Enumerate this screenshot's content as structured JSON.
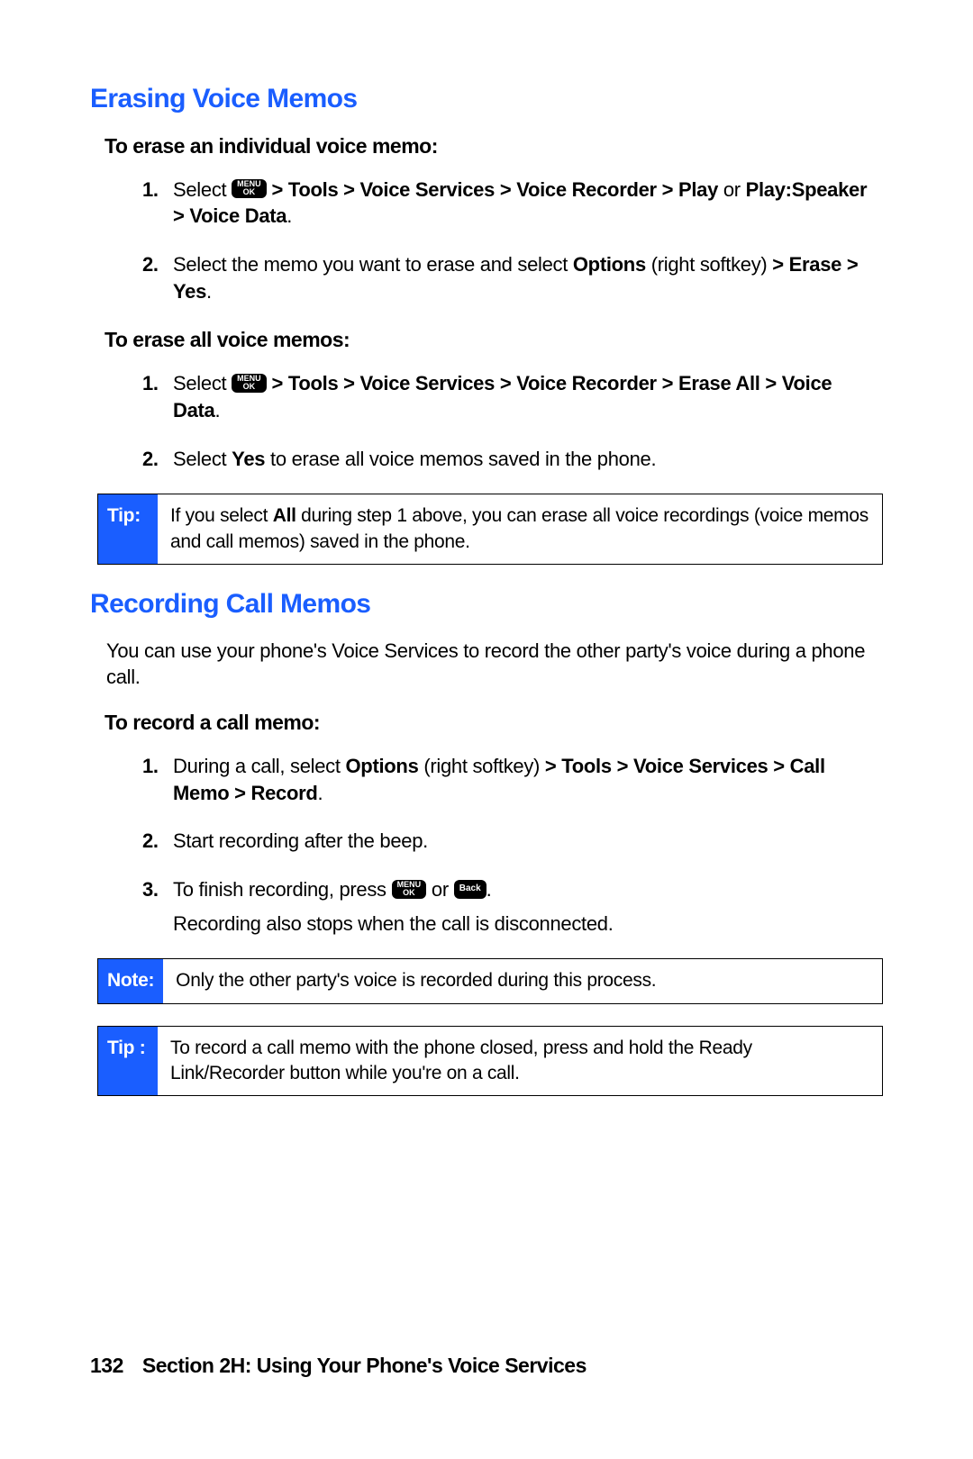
{
  "colors": {
    "accent": "#1a5eff"
  },
  "erasing": {
    "heading": "Erasing Voice Memos",
    "sub1": "To erase an individual voice memo:",
    "steps1": {
      "n1": "1.",
      "s1_pre": "Select ",
      "s1_bold1": " > Tools > Voice Services > Voice Recorder > Play ",
      "s1_post": "or ",
      "s1_bold2": "Play:Speaker > Voice Data",
      "s1_end": ".",
      "n2": "2.",
      "s2_pre": "Select the memo you want to erase and select ",
      "s2_bold1": "Options",
      "s2_mid": " (right softkey) ",
      "s2_bold2": "> Erase > Yes",
      "s2_end": "."
    },
    "sub2": "To erase all voice memos:",
    "steps2": {
      "n1": "1.",
      "s1_pre": "Select ",
      "s1_bold1": " > Tools > Voice Services > Voice Recorder > Erase All > Voice Data",
      "s1_end": ".",
      "n2": "2.",
      "s2_pre": "Select ",
      "s2_bold1": "Yes",
      "s2_post": " to erase all voice memos saved in the phone."
    },
    "tip": {
      "label": "Tip:",
      "pre": "If you select ",
      "bold": "All",
      "post": " during step 1 above, you can erase all voice recordings (voice memos and call memos) saved in the phone."
    }
  },
  "recording": {
    "heading": "Recording Call Memos",
    "intro": "You can use your phone's Voice Services to record the other party's voice during a phone call.",
    "sub": "To record a call memo:",
    "steps": {
      "n1": "1.",
      "s1_pre": "During a call, select ",
      "s1_bold1": "Options",
      "s1_mid": " (right softkey) ",
      "s1_bold2": "> Tools > Voice Services > Call Memo > Record",
      "s1_end": ".",
      "n2": "2.",
      "s2": "Start recording after the beep.",
      "n3": "3.",
      "s3_pre": "To finish recording, press ",
      "s3_mid": " or ",
      "s3_end": ".",
      "s3_cont": "Recording also stops when the call is disconnected."
    },
    "note": {
      "label": "Note:",
      "text": "Only the other party's voice is recorded during this process."
    },
    "tip2": {
      "label": "Tip :",
      "text": "To record a call memo with the phone closed, press and hold the Ready Link/Recorder button while you're on a call."
    }
  },
  "keys": {
    "menu_l1": "MENU",
    "menu_l2": "OK",
    "back": "Back"
  },
  "footer": {
    "page": "132",
    "section": "Section 2H: Using Your Phone's Voice Services"
  }
}
